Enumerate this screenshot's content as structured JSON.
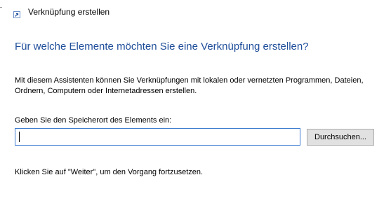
{
  "window": {
    "title": "Verknüpfung erstellen",
    "title_icon": "shortcut-icon"
  },
  "content": {
    "heading": "Für welche Elemente möchten Sie eine Verknüpfung erstellen?",
    "description": "Mit diesem Assistenten können Sie Verknüpfungen mit lokalen oder vernetzten Programmen, Dateien, Ordnern, Computern oder Internetadressen erstellen.",
    "location_label": "Geben Sie den Speicherort des Elements ein:",
    "location_value": "",
    "browse_label": "Durchsuchen...",
    "instruction": "Klicken Sie auf \"Weiter\", um den Vorgang fortzusetzen."
  },
  "colors": {
    "heading": "#1f4e9a",
    "input_focus_border": "#3f7bd0",
    "button_background": "#e1e1e1",
    "button_border": "#adadad"
  }
}
